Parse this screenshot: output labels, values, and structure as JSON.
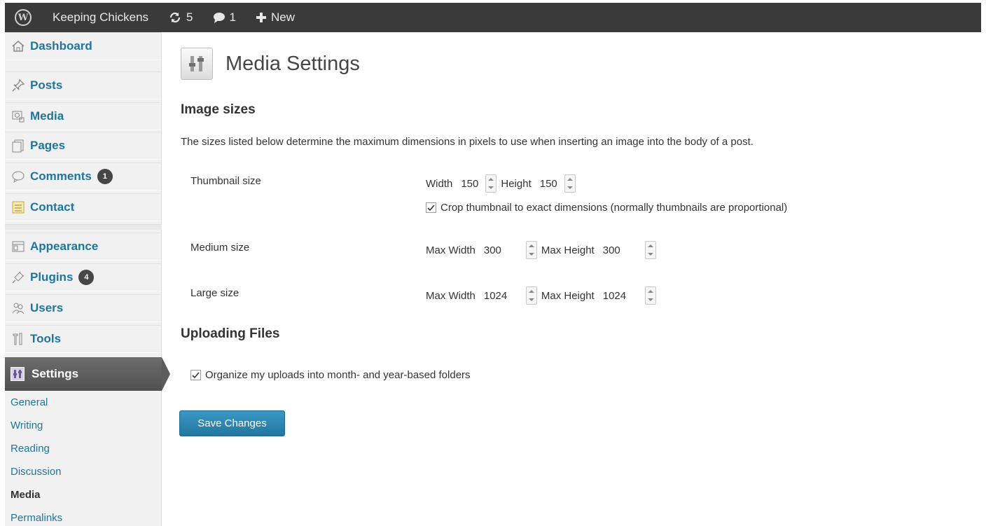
{
  "admin_bar": {
    "site_name": "Keeping Chickens",
    "updates_count": "5",
    "comments_count": "1",
    "new_label": "New"
  },
  "sidebar": {
    "items": [
      {
        "label": "Dashboard",
        "icon": "home-icon"
      },
      {
        "label": "Posts",
        "icon": "pushpin-icon"
      },
      {
        "label": "Media",
        "icon": "media-icon"
      },
      {
        "label": "Pages",
        "icon": "pages-icon"
      },
      {
        "label": "Comments",
        "icon": "comment-bubble-icon",
        "badge": "1"
      },
      {
        "label": "Contact",
        "icon": "contact-form-icon"
      },
      {
        "label": "Appearance",
        "icon": "appearance-icon"
      },
      {
        "label": "Plugins",
        "icon": "plug-icon",
        "badge": "4"
      },
      {
        "label": "Users",
        "icon": "users-icon"
      },
      {
        "label": "Tools",
        "icon": "tools-icon"
      }
    ],
    "current": {
      "label": "Settings",
      "icon": "settings-icon"
    },
    "submenu": [
      "General",
      "Writing",
      "Reading",
      "Discussion",
      "Media",
      "Permalinks"
    ],
    "submenu_current": "Media"
  },
  "page": {
    "title": "Media Settings",
    "image_sizes_heading": "Image sizes",
    "intro": "The sizes listed below determine the maximum dimensions in pixels to use when inserting an image into the body of a post.",
    "thumbnail": {
      "label": "Thumbnail size",
      "width_label": "Width",
      "width_value": "150",
      "height_label": "Height",
      "height_value": "150",
      "crop_label": "Crop thumbnail to exact dimensions (normally thumbnails are proportional)",
      "crop_checked": true
    },
    "medium": {
      "label": "Medium size",
      "width_label": "Max Width",
      "width_value": "300",
      "height_label": "Max Height",
      "height_value": "300"
    },
    "large": {
      "label": "Large size",
      "width_label": "Max Width",
      "width_value": "1024",
      "height_label": "Max Height",
      "height_value": "1024"
    },
    "uploading_heading": "Uploading Files",
    "organize_label": "Organize my uploads into month- and year-based folders",
    "organize_checked": true,
    "save_label": "Save Changes"
  },
  "colors": {
    "admin_bar_bg": "#3a3a3a",
    "link_blue": "#21759b",
    "button_blue": "#2e8ab8",
    "current_menu_bg": "#5c5c5c"
  }
}
